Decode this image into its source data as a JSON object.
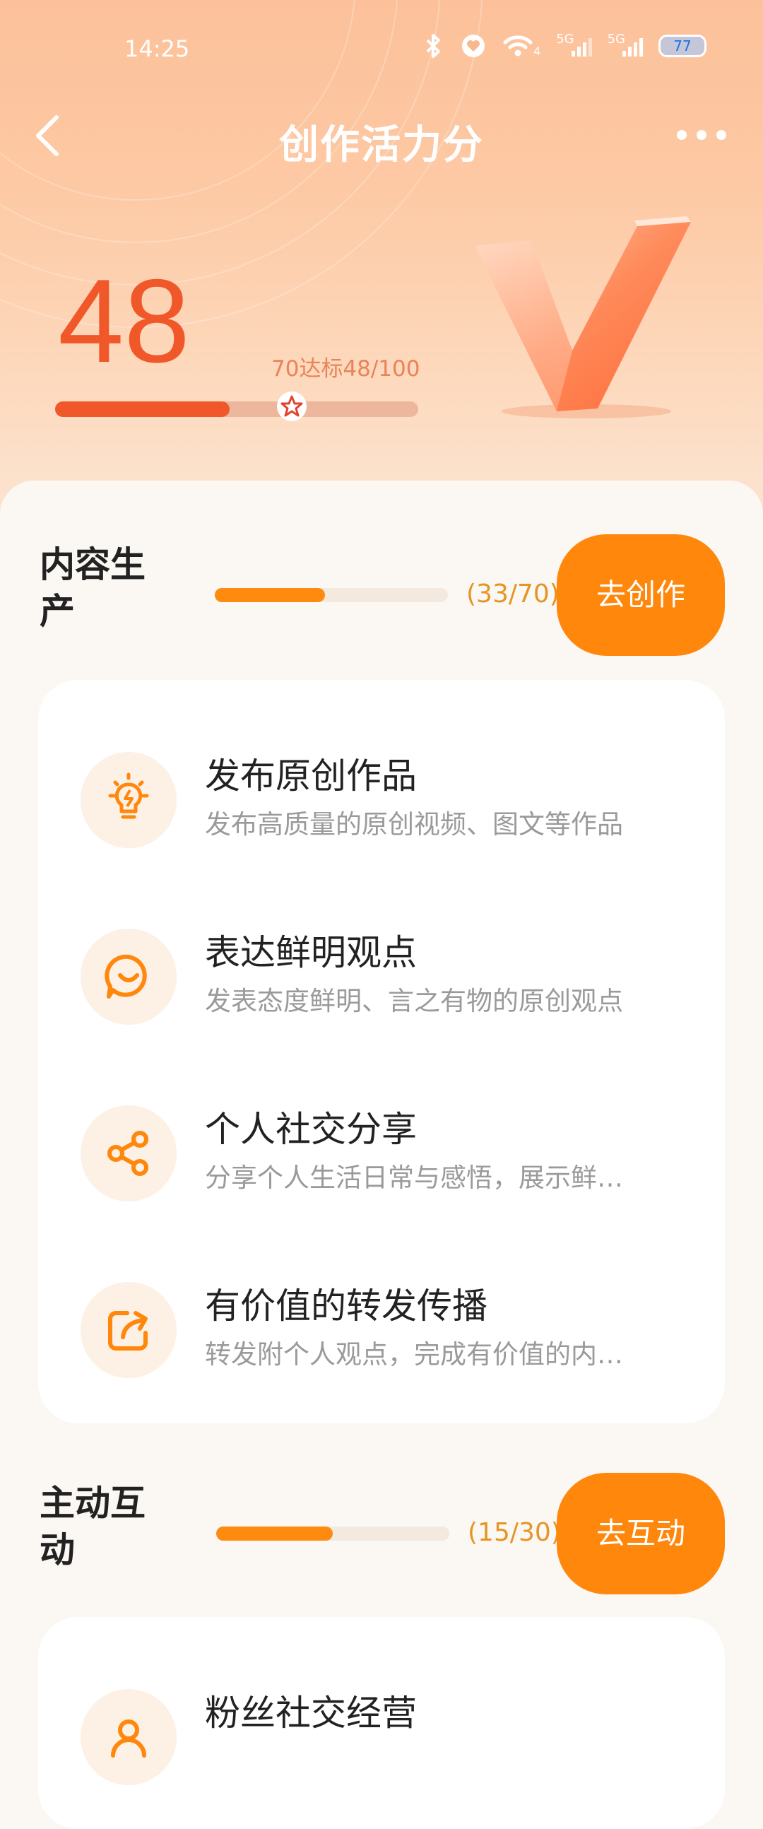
{
  "status_bar": {
    "time": "14:25",
    "net1": "5G",
    "net2": "5G",
    "wifi_sub": "4",
    "battery": "77"
  },
  "nav": {
    "title": "创作活力分"
  },
  "score": {
    "value": "48",
    "target_text": "70达标48/100",
    "progress": 0.48,
    "target_marker": 0.7
  },
  "sections": [
    {
      "title": "内容生产",
      "count": "(33/70)",
      "progress": 0.4714,
      "button": "去创作",
      "tasks": [
        {
          "icon": "lightbulb-icon",
          "title": "发布原创作品",
          "desc": "发布高质量的原创视频、图文等作品"
        },
        {
          "icon": "smile-chat-icon",
          "title": "表达鲜明观点",
          "desc": "发表态度鲜明、言之有物的原创观点"
        },
        {
          "icon": "share-icon",
          "title": "个人社交分享",
          "desc": "分享个人生活日常与感悟，展示鲜…"
        },
        {
          "icon": "forward-icon",
          "title": "有价值的转发传播",
          "desc": "转发附个人观点，完成有价值的内…"
        }
      ]
    },
    {
      "title": "主动互动",
      "count": "(15/30)",
      "progress": 0.5,
      "button": "去互动",
      "tasks": [
        {
          "icon": "fans-icon",
          "title": "粉丝社交经营",
          "desc": ""
        }
      ]
    }
  ],
  "colors": {
    "accent": "#ff870c",
    "score": "#f0582a",
    "count": "#e69425"
  }
}
